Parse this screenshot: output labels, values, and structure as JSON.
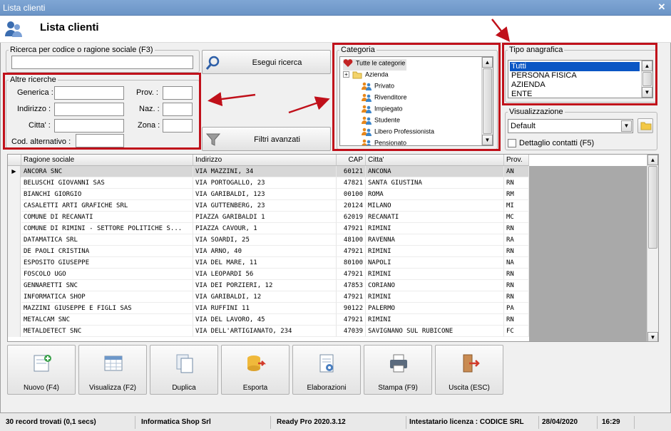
{
  "window": {
    "title": "Lista clienti"
  },
  "header": {
    "title": "Lista clienti"
  },
  "search": {
    "group_label": "Ricerca per codice o ragione sociale (F3)",
    "value": "",
    "button_label": "Esegui ricerca"
  },
  "altre_ricerche": {
    "group_label": "Altre ricerche",
    "fields": {
      "generica": "Generica :",
      "indirizzo": "Indirizzo :",
      "citta": "Citta' :",
      "cod_alternativo": "Cod. alternativo :",
      "prov": "Prov. :",
      "naz": "Naz. :",
      "zona": "Zona :"
    },
    "filtri_label": "Filtri avanzati"
  },
  "categoria": {
    "group_label": "Categoria",
    "items": [
      "Tutte le categorie",
      "Azienda",
      "Privato",
      "Rivenditore",
      "Impiegato",
      "Studente",
      "Libero Professionista",
      "Pensionato"
    ]
  },
  "tipo_anagrafica": {
    "group_label": "Tipo anagrafica",
    "items": [
      "Tutti",
      "PERSONA FISICA",
      "AZIENDA",
      "ENTE"
    ],
    "selected": "Tutti"
  },
  "visualizzazione": {
    "group_label": "Visualizzazione",
    "selected": "Default",
    "dettaglio_label": "Dettaglio contatti (F5)"
  },
  "grid": {
    "columns": [
      "Ragione sociale",
      "Indirizzo",
      "CAP",
      "Citta'",
      "Prov."
    ],
    "rows": [
      [
        "ANCORA SNC",
        "VIA MAZZINI, 34",
        "60121",
        "ANCONA",
        "AN"
      ],
      [
        "BELUSCHI GIOVANNI SAS",
        "VIA PORTOGALLO, 23",
        "47821",
        "SANTA GIUSTINA",
        "RN"
      ],
      [
        "BIANCHI GIORGIO",
        "VIA GARIBALDI, 123",
        "00100",
        "ROMA",
        "RM"
      ],
      [
        "CASALETTI ARTI GRAFICHE SRL",
        "VIA GUTTENBERG, 23",
        "20124",
        "MILANO",
        "MI"
      ],
      [
        "COMUNE DI RECANATI",
        "PIAZZA GARIBALDI 1",
        "62019",
        "RECANATI",
        "MC"
      ],
      [
        "COMUNE DI RIMINI - SETTORE POLITICHE S...",
        "PIAZZA CAVOUR, 1",
        "47921",
        "RIMINI",
        "RN"
      ],
      [
        "DATAMATICA SRL",
        "VIA SOARDI, 25",
        "48100",
        "RAVENNA",
        "RA"
      ],
      [
        "DE PAOLI CRISTINA",
        "VIA ARNO, 40",
        "47921",
        "RIMINI",
        "RN"
      ],
      [
        "ESPOSITO GIUSEPPE",
        "VIA DEL MARE, 11",
        "80100",
        "NAPOLI",
        "NA"
      ],
      [
        "FOSCOLO UGO",
        "VIA LEOPARDI 56",
        "47921",
        "RIMINI",
        "RN"
      ],
      [
        "GENNARETTI SNC",
        "VIA DEI PORZIERI, 12",
        "47853",
        "CORIANO",
        "RN"
      ],
      [
        "INFORMATICA SHOP",
        "VIA GARIBALDI, 12",
        "47921",
        "RIMINI",
        "RN"
      ],
      [
        "MAZZINI GIUSEPPE E FIGLI SAS",
        "VIA RUFFINI 11",
        "90122",
        "PALERMO",
        "PA"
      ],
      [
        "METALCAM SNC",
        "VIA DEL LAVORO, 45",
        "47921",
        "RIMINI",
        "RN"
      ],
      [
        "METALDETECT SNC",
        "VIA DELL'ARTIGIANATO, 234",
        "47039",
        "SAVIGNANO SUL RUBICONE",
        "FC"
      ]
    ]
  },
  "toolbar": {
    "buttons": [
      {
        "label": "Nuovo (F4)",
        "icon": "new-record-icon"
      },
      {
        "label": "Visualizza (F2)",
        "icon": "view-grid-icon"
      },
      {
        "label": "Duplica",
        "icon": "duplicate-icon"
      },
      {
        "label": "Esporta",
        "icon": "export-icon"
      },
      {
        "label": "Elaborazioni",
        "icon": "processing-icon"
      },
      {
        "label": "Stampa (F9)",
        "icon": "printer-icon"
      },
      {
        "label": "Uscita (ESC)",
        "icon": "exit-icon"
      }
    ]
  },
  "status": {
    "records": "30 record trovati (0,1 secs)",
    "company": "Informatica Shop Srl",
    "version": "Ready Pro 2020.3.12",
    "license": "Intestatario licenza : CODICE SRL",
    "date": "28/04/2020",
    "time": "16:29"
  },
  "colors": {
    "titlebar": "#6b94c6",
    "annotation_red": "#c0101a",
    "selection": "#0a56c4"
  }
}
